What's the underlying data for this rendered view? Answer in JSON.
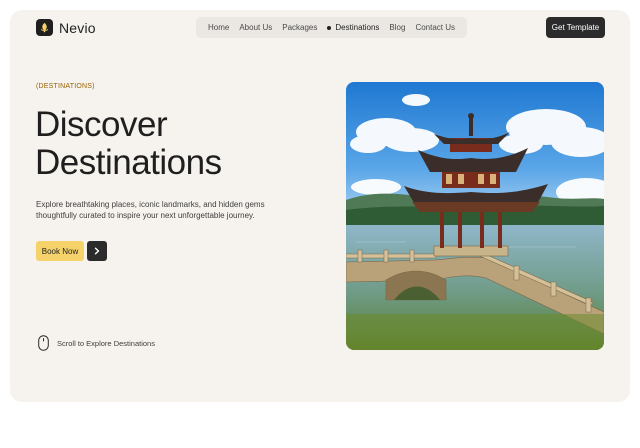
{
  "brand": {
    "name": "Nevio",
    "icon": "leaf-icon"
  },
  "nav": {
    "items": [
      {
        "label": "Home",
        "active": false
      },
      {
        "label": "About Us",
        "active": false
      },
      {
        "label": "Packages",
        "active": false
      },
      {
        "label": "Destinations",
        "active": true
      },
      {
        "label": "Blog",
        "active": false
      },
      {
        "label": "Contact Us",
        "active": false
      }
    ]
  },
  "header": {
    "cta_label": "Get Template"
  },
  "hero": {
    "eyebrow": "(DESTINATIONS)",
    "title_line1": "Discover",
    "title_line2": "Destinations",
    "subtitle": "Explore breathtaking places, iconic landmarks, and hidden gems thoughtfully curated to inspire your next unforgettable journey.",
    "book_label": "Book Now",
    "arrow_icon": "chevron-right-icon",
    "scroll_label": "Scroll to Explore Destinations",
    "scroll_icon": "mouse-icon",
    "image_subject": "pagoda-lake-image"
  },
  "colors": {
    "page_bg": "#f6f3ee",
    "accent_yellow": "#f6d36a",
    "dark": "#2b2b2b",
    "eyebrow": "#9a6200"
  }
}
